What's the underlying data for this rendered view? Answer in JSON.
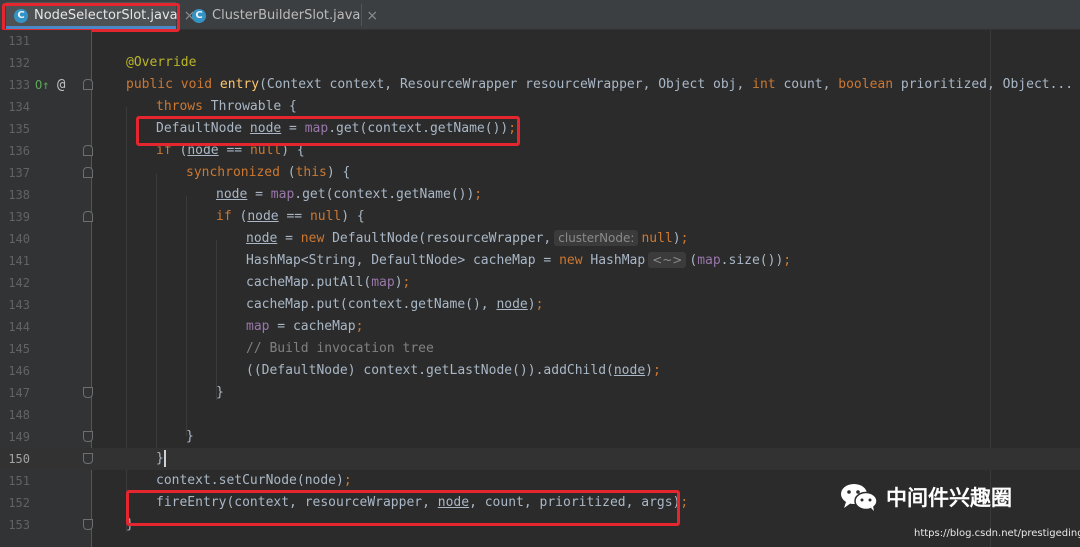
{
  "tabs": [
    {
      "label": "NodeSelectorSlot.java",
      "icon": "class-icon",
      "icon_letter": "C",
      "active": true
    },
    {
      "label": "ClusterBuilderSlot.java",
      "icon": "class-icon",
      "icon_letter": "C",
      "active": false
    }
  ],
  "close_glyph": "×",
  "gutter_markers": {
    "line133_override": "O↑",
    "line133_at": "@"
  },
  "lines": [
    {
      "num": "131"
    },
    {
      "num": "132",
      "text": "@Override"
    },
    {
      "num": "133",
      "kw1": "public void ",
      "fn": "entry",
      "p1": "(Context context, ResourceWrapper resourceWrapper, Object obj, ",
      "kw2": "int",
      "p2": " count, ",
      "kw3": "boolean",
      "p3": " prioritized, Object... args)"
    },
    {
      "num": "134",
      "kw": "throws",
      "rest": " Throwable {"
    },
    {
      "num": "135",
      "a": "DefaultNode ",
      "var": "node",
      "b": " = ",
      "fld": "map",
      "c": ".get(context.getName())",
      "d": ";"
    },
    {
      "num": "136",
      "kw": "if",
      "a": " (",
      "var": "node",
      "b": " == ",
      "kw2": "null",
      "c": ") {"
    },
    {
      "num": "137",
      "kw": "synchronized",
      "a": " (",
      "kw2": "this",
      "b": ") {"
    },
    {
      "num": "138",
      "var": "node",
      "a": " = ",
      "fld": "map",
      "b": ".get(context.getName())",
      "c": ";"
    },
    {
      "num": "139",
      "kw": "if",
      "a": " (",
      "var": "node",
      "b": " == ",
      "kw2": "null",
      "c": ") {"
    },
    {
      "num": "140",
      "var": "node",
      "a": " = ",
      "kw": "new",
      "b": " DefaultNode(resourceWrapper,",
      "hint": "clusterNode:",
      "kw2": "null",
      "c": ")",
      "d": ";"
    },
    {
      "num": "141",
      "a": "HashMap<String, DefaultNode> cacheMap = ",
      "kw": "new",
      "b": " HashMap",
      "hint": "<~>",
      "c": "(",
      "fld": "map",
      "d": ".size())",
      "e": ";"
    },
    {
      "num": "142",
      "a": "cacheMap.putAll(",
      "fld": "map",
      "b": ")",
      "c": ";"
    },
    {
      "num": "143",
      "a": "cacheMap.put(context.getName(), ",
      "var": "node",
      "b": ")",
      "c": ";"
    },
    {
      "num": "144",
      "fld": "map",
      "a": " = cacheMap",
      "b": ";"
    },
    {
      "num": "145",
      "cmt": "// Build invocation tree"
    },
    {
      "num": "146",
      "a": "((DefaultNode) context.getLastNode()).addChild(",
      "var": "node",
      "b": ")",
      "c": ";"
    },
    {
      "num": "147",
      "a": "}"
    },
    {
      "num": "148"
    },
    {
      "num": "149",
      "a": "}"
    },
    {
      "num": "150",
      "a": "}"
    },
    {
      "num": "151",
      "a": "context.setCurNode(node)",
      "b": ";"
    },
    {
      "num": "152",
      "a": "fireEntry(context, resourceWrapper, ",
      "var": "node",
      "b": ", count, prioritized, args)",
      "c": ";"
    },
    {
      "num": "153",
      "a": "}"
    }
  ],
  "watermark": {
    "title": "中间件兴趣圈",
    "url": "https://blog.csdn.net/prestigeding"
  },
  "colors": {
    "highlight_box": "#e5262f",
    "background": "#2b2b2b",
    "keyword": "#cc7832",
    "annotation": "#bbb529",
    "method": "#ffc66d",
    "field": "#9876aa"
  }
}
